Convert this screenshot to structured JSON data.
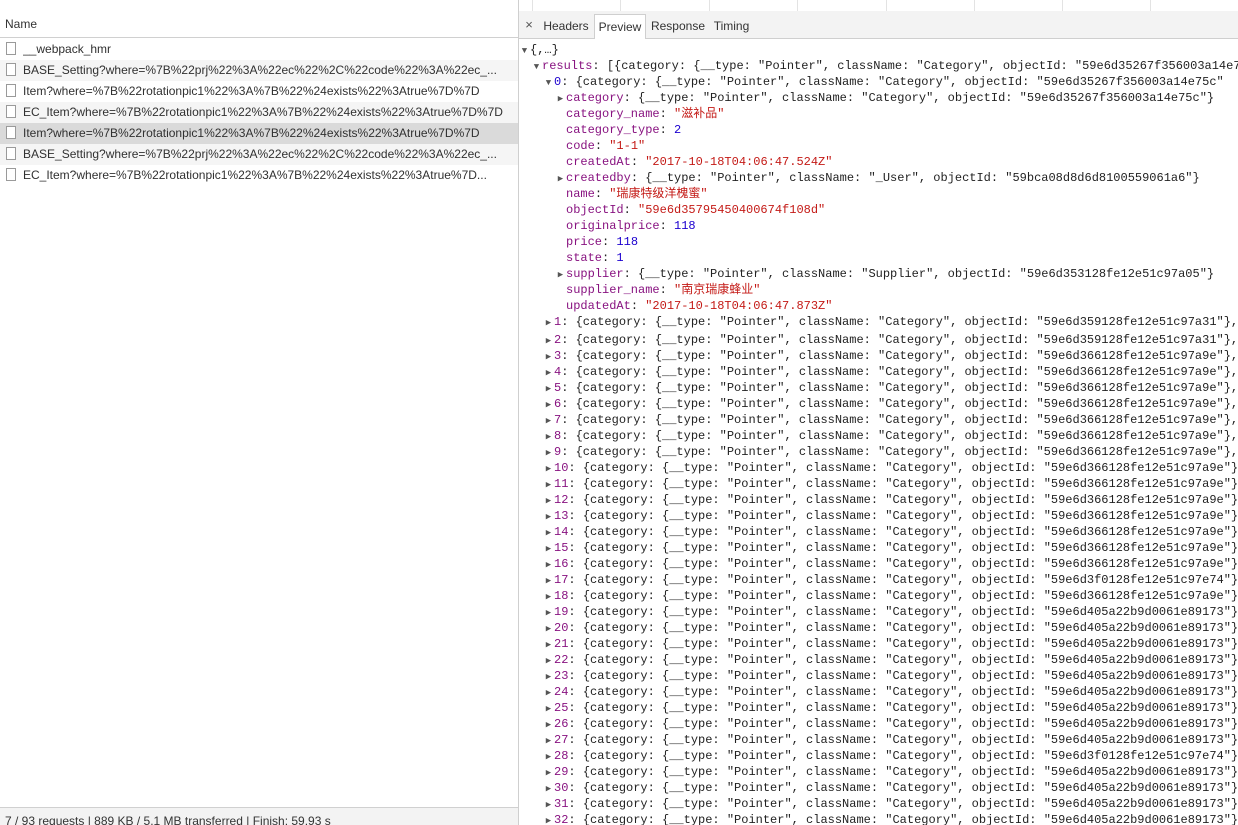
{
  "requests_panel": {
    "name_header": "Name",
    "requests": [
      {
        "name": "__webpack_hmr",
        "state": "normal"
      },
      {
        "name": "BASE_Setting?where=%7B%22prj%22%3A%22ec%22%2C%22code%22%3A%22ec_...",
        "state": "alt"
      },
      {
        "name": "Item?where=%7B%22rotationpic1%22%3A%7B%22%24exists%22%3Atrue%7D%7D",
        "state": "normal"
      },
      {
        "name": "EC_Item?where=%7B%22rotationpic1%22%3A%7B%22%24exists%22%3Atrue%7D%7D",
        "state": "alt"
      },
      {
        "name": "Item?where=%7B%22rotationpic1%22%3A%7B%22%24exists%22%3Atrue%7D%7D",
        "state": "selected"
      },
      {
        "name": "BASE_Setting?where=%7B%22prj%22%3A%22ec%22%2C%22code%22%3A%22ec_...",
        "state": "alt"
      },
      {
        "name": "EC_Item?where=%7B%22rotationpic1%22%3A%7B%22%24exists%22%3Atrue%7D...",
        "state": "normal"
      }
    ],
    "status_bar": "7 / 93 requests | 889 KB / 5.1 MB transferred | Finish: 59.93 s"
  },
  "detail_panel": {
    "close_glyph": "×",
    "tabs": [
      {
        "label": "Headers",
        "active": false
      },
      {
        "label": "Preview",
        "active": true
      },
      {
        "label": "Response",
        "active": false
      },
      {
        "label": "Timing",
        "active": false
      }
    ],
    "root_summary": "{,…}",
    "results_key": "results",
    "results_summary": "[{category: {__type: \"Pointer\", className: \"Category\", objectId: \"59e6d35267f356003a14e7",
    "item0": {
      "index": "0",
      "summary": "{category: {__type: \"Pointer\", className: \"Category\", objectId: \"59e6d35267f356003a14e75c\"",
      "fields": [
        {
          "key": "category",
          "expandable": true,
          "type": "plain",
          "value": "{__type: \"Pointer\", className: \"Category\", objectId: \"59e6d35267f356003a14e75c\"}"
        },
        {
          "key": "category_name",
          "expandable": false,
          "type": "str",
          "value": "\"滋补品\""
        },
        {
          "key": "category_type",
          "expandable": false,
          "type": "num",
          "value": "2"
        },
        {
          "key": "code",
          "expandable": false,
          "type": "str",
          "value": "\"1-1\""
        },
        {
          "key": "createdAt",
          "expandable": false,
          "type": "str",
          "value": "\"2017-10-18T04:06:47.524Z\""
        },
        {
          "key": "createdby",
          "expandable": true,
          "type": "plain",
          "value": "{__type: \"Pointer\", className: \"_User\", objectId: \"59bca08d8d6d8100559061a6\"}"
        },
        {
          "key": "name",
          "expandable": false,
          "type": "str",
          "value": "\"瑞康特级洋槐蜜\""
        },
        {
          "key": "objectId",
          "expandable": false,
          "type": "str",
          "value": "\"59e6d35795450400674f108d\""
        },
        {
          "key": "originalprice",
          "expandable": false,
          "type": "num",
          "value": "118"
        },
        {
          "key": "price",
          "expandable": false,
          "type": "num",
          "value": "118"
        },
        {
          "key": "state",
          "expandable": false,
          "type": "num",
          "value": "1"
        },
        {
          "key": "supplier",
          "expandable": true,
          "type": "plain",
          "value": "{__type: \"Pointer\", className: \"Supplier\", objectId: \"59e6d353128fe12e51c97a05\"}"
        },
        {
          "key": "supplier_name",
          "expandable": false,
          "type": "str",
          "value": "\"南京瑞康蜂业\""
        },
        {
          "key": "updatedAt",
          "expandable": false,
          "type": "str",
          "value": "\"2017-10-18T04:06:47.873Z\""
        }
      ]
    },
    "collapsed_items": [
      {
        "index": "1",
        "text": "{category: {__type: \"Pointer\", className: \"Category\", objectId: \"59e6d359128fe12e51c97a31\"},"
      },
      {
        "index": "2",
        "text": "{category: {__type: \"Pointer\", className: \"Category\", objectId: \"59e6d359128fe12e51c97a31\"},"
      },
      {
        "index": "3",
        "text": "{category: {__type: \"Pointer\", className: \"Category\", objectId: \"59e6d366128fe12e51c97a9e\"},"
      },
      {
        "index": "4",
        "text": "{category: {__type: \"Pointer\", className: \"Category\", objectId: \"59e6d366128fe12e51c97a9e\"},"
      },
      {
        "index": "5",
        "text": "{category: {__type: \"Pointer\", className: \"Category\", objectId: \"59e6d366128fe12e51c97a9e\"},"
      },
      {
        "index": "6",
        "text": "{category: {__type: \"Pointer\", className: \"Category\", objectId: \"59e6d366128fe12e51c97a9e\"},"
      },
      {
        "index": "7",
        "text": "{category: {__type: \"Pointer\", className: \"Category\", objectId: \"59e6d366128fe12e51c97a9e\"},"
      },
      {
        "index": "8",
        "text": "{category: {__type: \"Pointer\", className: \"Category\", objectId: \"59e6d366128fe12e51c97a9e\"},"
      },
      {
        "index": "9",
        "text": "{category: {__type: \"Pointer\", className: \"Category\", objectId: \"59e6d366128fe12e51c97a9e\"},"
      },
      {
        "index": "10",
        "text": "{category: {__type: \"Pointer\", className: \"Category\", objectId: \"59e6d366128fe12e51c97a9e\"}"
      },
      {
        "index": "11",
        "text": "{category: {__type: \"Pointer\", className: \"Category\", objectId: \"59e6d366128fe12e51c97a9e\"}"
      },
      {
        "index": "12",
        "text": "{category: {__type: \"Pointer\", className: \"Category\", objectId: \"59e6d366128fe12e51c97a9e\"}"
      },
      {
        "index": "13",
        "text": "{category: {__type: \"Pointer\", className: \"Category\", objectId: \"59e6d366128fe12e51c97a9e\"}"
      },
      {
        "index": "14",
        "text": "{category: {__type: \"Pointer\", className: \"Category\", objectId: \"59e6d366128fe12e51c97a9e\"}"
      },
      {
        "index": "15",
        "text": "{category: {__type: \"Pointer\", className: \"Category\", objectId: \"59e6d366128fe12e51c97a9e\"}"
      },
      {
        "index": "16",
        "text": "{category: {__type: \"Pointer\", className: \"Category\", objectId: \"59e6d366128fe12e51c97a9e\"}"
      },
      {
        "index": "17",
        "text": "{category: {__type: \"Pointer\", className: \"Category\", objectId: \"59e6d3f0128fe12e51c97e74\"}"
      },
      {
        "index": "18",
        "text": "{category: {__type: \"Pointer\", className: \"Category\", objectId: \"59e6d366128fe12e51c97a9e\"}"
      },
      {
        "index": "19",
        "text": "{category: {__type: \"Pointer\", className: \"Category\", objectId: \"59e6d405a22b9d0061e89173\"}"
      },
      {
        "index": "20",
        "text": "{category: {__type: \"Pointer\", className: \"Category\", objectId: \"59e6d405a22b9d0061e89173\"}"
      },
      {
        "index": "21",
        "text": "{category: {__type: \"Pointer\", className: \"Category\", objectId: \"59e6d405a22b9d0061e89173\"}"
      },
      {
        "index": "22",
        "text": "{category: {__type: \"Pointer\", className: \"Category\", objectId: \"59e6d405a22b9d0061e89173\"}"
      },
      {
        "index": "23",
        "text": "{category: {__type: \"Pointer\", className: \"Category\", objectId: \"59e6d405a22b9d0061e89173\"}"
      },
      {
        "index": "24",
        "text": "{category: {__type: \"Pointer\", className: \"Category\", objectId: \"59e6d405a22b9d0061e89173\"}"
      },
      {
        "index": "25",
        "text": "{category: {__type: \"Pointer\", className: \"Category\", objectId: \"59e6d405a22b9d0061e89173\"}"
      },
      {
        "index": "26",
        "text": "{category: {__type: \"Pointer\", className: \"Category\", objectId: \"59e6d405a22b9d0061e89173\"}"
      },
      {
        "index": "27",
        "text": "{category: {__type: \"Pointer\", className: \"Category\", objectId: \"59e6d405a22b9d0061e89173\"}"
      },
      {
        "index": "28",
        "text": "{category: {__type: \"Pointer\", className: \"Category\", objectId: \"59e6d3f0128fe12e51c97e74\"}"
      },
      {
        "index": "29",
        "text": "{category: {__type: \"Pointer\", className: \"Category\", objectId: \"59e6d405a22b9d0061e89173\"}"
      },
      {
        "index": "30",
        "text": "{category: {__type: \"Pointer\", className: \"Category\", objectId: \"59e6d405a22b9d0061e89173\"}"
      },
      {
        "index": "31",
        "text": "{category: {__type: \"Pointer\", className: \"Category\", objectId: \"59e6d405a22b9d0061e89173\"}"
      },
      {
        "index": "32",
        "text": "{category: {__type: \"Pointer\", className: \"Category\", objectId: \"59e6d405a22b9d0061e89173\"}"
      }
    ]
  },
  "colors": {
    "json_key": "#881280",
    "json_string": "#c41a16",
    "json_number": "#1c00cf",
    "selected_row": "#dadada"
  }
}
